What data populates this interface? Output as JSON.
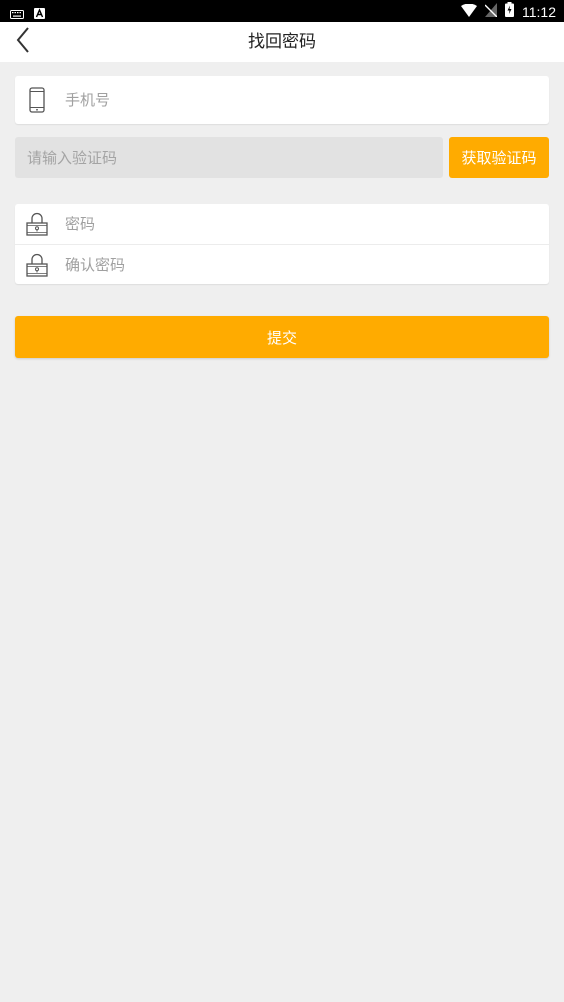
{
  "statusbar": {
    "time": "11:12",
    "icons": [
      "keyboard-icon",
      "a-icon",
      "wifi-icon",
      "no-sim-icon",
      "battery-charging-icon"
    ]
  },
  "navbar": {
    "title": "找回密码",
    "back_icon": "chevron-left-icon"
  },
  "form": {
    "phone": {
      "placeholder": "手机号",
      "value": "",
      "icon": "phone-icon"
    },
    "code": {
      "placeholder": "请输入验证码",
      "value": ""
    },
    "get_code_label": "获取验证码",
    "password": {
      "placeholder": "密码",
      "value": "",
      "icon": "lock-icon"
    },
    "confirm_password": {
      "placeholder": "确认密码",
      "value": "",
      "icon": "lock-icon"
    },
    "submit_label": "提交"
  },
  "colors": {
    "accent": "#ffab00",
    "background": "#efefef",
    "statusbar": "#000000"
  }
}
